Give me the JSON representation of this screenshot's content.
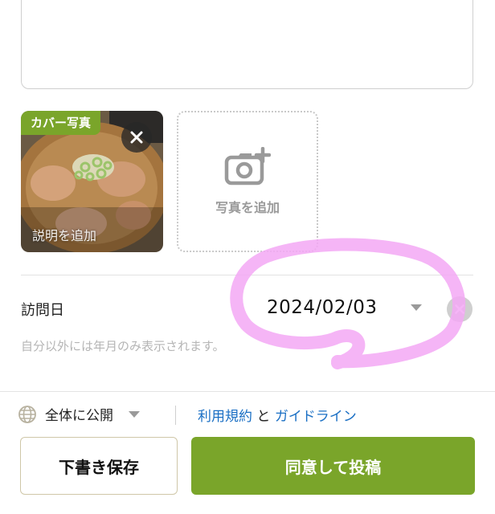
{
  "photos": {
    "cover_badge": "カバー写真",
    "caption_placeholder": "説明を追加",
    "add_photo_label": "写真を追加"
  },
  "visit": {
    "label": "訪問日",
    "date": "2024/02/03",
    "note": "自分以外には年月のみ表示されます。"
  },
  "footer": {
    "visibility": "全体に公開",
    "terms_link": "利用規約",
    "and": " と ",
    "guideline_link": "ガイドライン",
    "draft_button": "下書き保存",
    "post_button": "同意して投稿"
  },
  "colors": {
    "accent_green": "#7aa52a",
    "link_blue": "#1a6fc4",
    "highlight_pink": "#f3a8f5"
  },
  "icons": [
    "close-icon",
    "camera-add-icon",
    "globe-icon",
    "caret-down-icon"
  ]
}
